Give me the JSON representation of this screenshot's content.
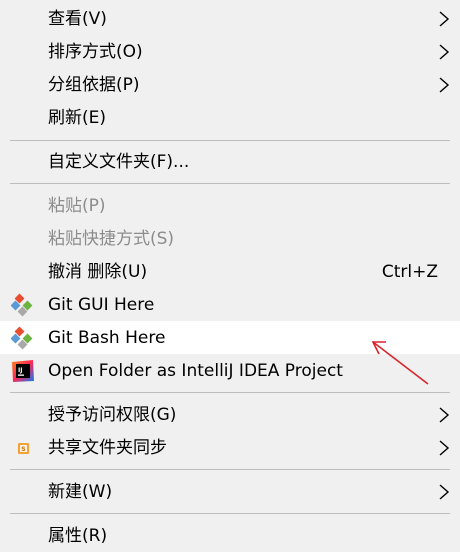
{
  "menu": {
    "view": "查看(V)",
    "sort_by": "排序方式(O)",
    "group_by": "分组依据(P)",
    "refresh": "刷新(E)",
    "customize_folder": "自定义文件夹(F)...",
    "paste": "粘贴(P)",
    "paste_shortcut": "粘贴快捷方式(S)",
    "undo_delete": "撤消 删除(U)",
    "undo_shortcut": "Ctrl+Z",
    "git_gui": "Git GUI Here",
    "git_bash": "Git Bash Here",
    "open_intellij": "Open Folder as IntelliJ IDEA Project",
    "grant_access": "授予访问权限(G)",
    "share_sync": "共享文件夹同步",
    "new": "新建(W)",
    "properties": "属性(R)"
  },
  "icons": {
    "git": "git-icon",
    "intellij": "intellij-icon",
    "sync": "share-sync-icon",
    "submenu": "chevron-right-icon"
  },
  "colors": {
    "menu_bg": "#f0f0f0",
    "highlight_bg": "#ffffff",
    "disabled_text": "#8c8c8c",
    "separator": "#bdbdbd",
    "annotation_arrow": "#d9252a"
  }
}
